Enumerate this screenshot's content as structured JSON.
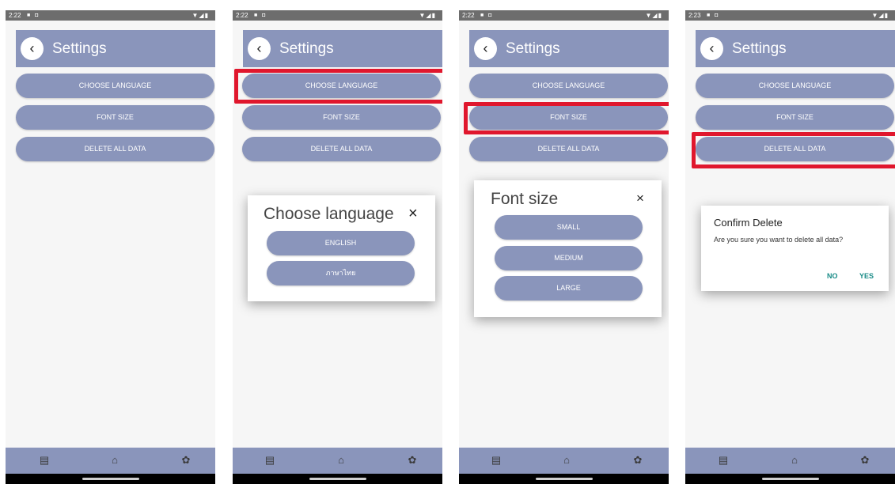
{
  "screens": [
    {
      "time": "2:22",
      "title": "Settings"
    },
    {
      "time": "2:22",
      "title": "Settings"
    },
    {
      "time": "2:22",
      "title": "Settings"
    },
    {
      "time": "2:23",
      "title": "Settings"
    }
  ],
  "status_icons": "■ ◘",
  "signal_icons": "▼◢▮",
  "menu": {
    "choose_language": "CHOOSE LANGUAGE",
    "font_size": "FONT SIZE",
    "delete_all_data": "DELETE ALL DATA"
  },
  "language_dialog": {
    "title": "Choose language",
    "close": "×",
    "options": [
      "ENGLISH",
      "ภาษาไทย"
    ]
  },
  "font_dialog": {
    "title": "Font size",
    "close": "×",
    "options": [
      "SMALL",
      "MEDIUM",
      "LARGE"
    ]
  },
  "confirm_dialog": {
    "title": "Confirm Delete",
    "message": "Are you sure you want to delete all data?",
    "no": "NO",
    "yes": "YES"
  },
  "nav": {
    "list_icon": "▤",
    "home_icon": "⌂",
    "settings_icon": "✿"
  },
  "colors": {
    "accent": "#8a95bb",
    "highlight": "#e0172d",
    "dialog_action": "#178a86"
  }
}
